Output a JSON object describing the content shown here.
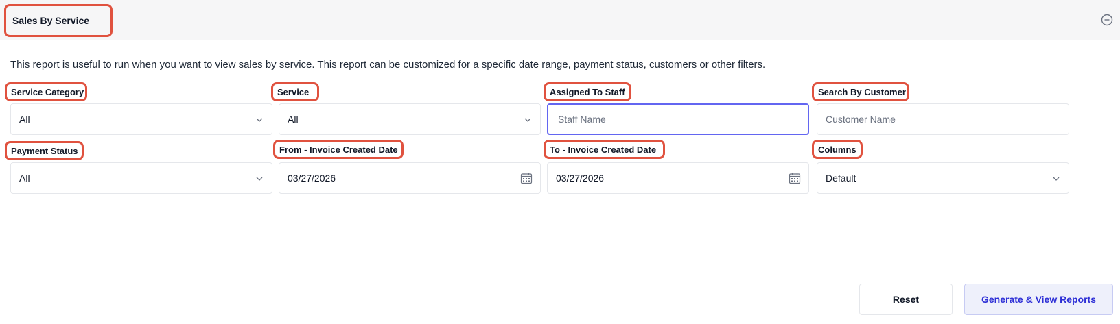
{
  "header": {
    "title": "Sales By Service",
    "collapse_icon": "minus-circle-icon"
  },
  "description": "This report is useful to run when you want to view sales by service. This report can be customized for a specific date range, payment status, customers or other filters.",
  "filters": {
    "service_category": {
      "label": "Service Category",
      "value": "All"
    },
    "service": {
      "label": "Service",
      "value": "All"
    },
    "assigned_staff": {
      "label": "Assigned To Staff",
      "placeholder": "Staff Name",
      "value": ""
    },
    "search_customer": {
      "label": "Search By Customer",
      "placeholder": "Customer Name",
      "value": ""
    },
    "payment_status": {
      "label": "Payment Status",
      "value": "All"
    },
    "from_date": {
      "label": "From - Invoice Created Date",
      "value": "03/27/2026"
    },
    "to_date": {
      "label": "To - Invoice Created Date",
      "value": "03/27/2026"
    },
    "columns": {
      "label": "Columns",
      "value": "Default"
    }
  },
  "actions": {
    "reset_label": "Reset",
    "generate_label": "Generate & View Reports"
  },
  "colors": {
    "highlight": "#e0523f",
    "focus": "#6366f1",
    "primary_text": "#2d2fd6",
    "primary_bg": "#eef0fb"
  }
}
